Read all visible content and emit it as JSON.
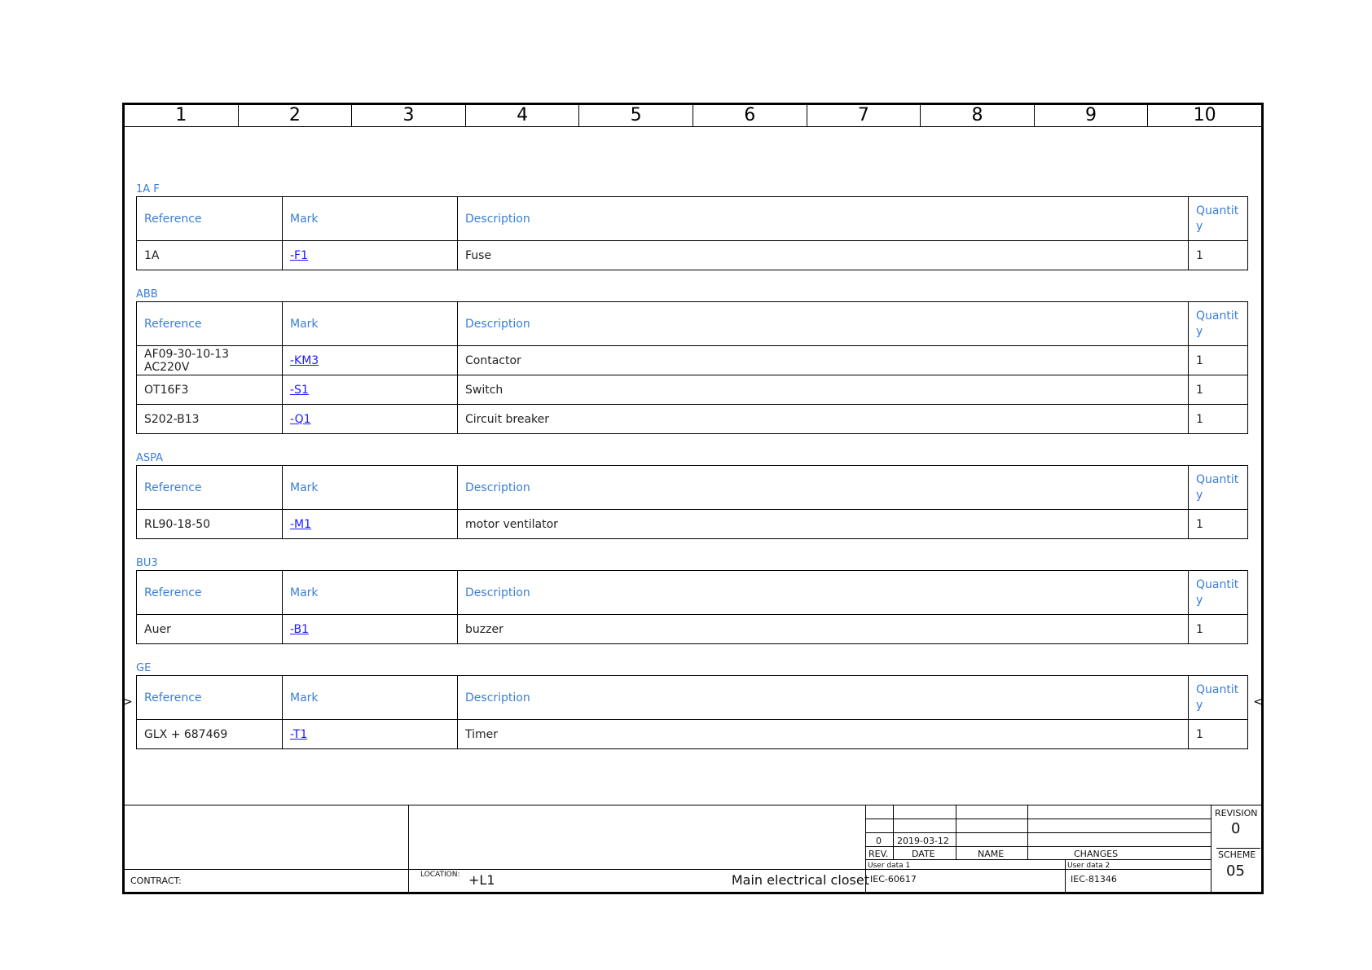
{
  "ruler": [
    "1",
    "2",
    "3",
    "4",
    "5",
    "6",
    "7",
    "8",
    "9",
    "10"
  ],
  "table_headers": {
    "reference": "Reference",
    "mark": "Mark",
    "description": "Description",
    "quantity_line1": "Quantit",
    "quantity_line2": "y"
  },
  "groups": [
    {
      "title": "1A F",
      "rows": [
        {
          "reference": "1A",
          "mark": "-F1",
          "description": "Fuse",
          "quantity": "1"
        }
      ]
    },
    {
      "title": "ABB",
      "rows": [
        {
          "reference": "AF09-30-10-13 AC220V",
          "mark": "-KM3",
          "description": "Contactor",
          "quantity": "1"
        },
        {
          "reference": "OT16F3",
          "mark": "-S1",
          "description": "Switch",
          "quantity": "1"
        },
        {
          "reference": "S202-B13",
          "mark": "-Q1",
          "description": "Circuit breaker",
          "quantity": "1"
        }
      ]
    },
    {
      "title": "ASPA",
      "rows": [
        {
          "reference": "RL90-18-50",
          "mark": "-M1",
          "description": "motor ventilator",
          "quantity": "1"
        }
      ]
    },
    {
      "title": "BU3",
      "rows": [
        {
          "reference": "Auer",
          "mark": "-B1",
          "description": "buzzer",
          "quantity": "1"
        }
      ]
    },
    {
      "title": "GE",
      "rows": [
        {
          "reference": "GLX + 687469",
          "mark": "-T1",
          "description": "Timer",
          "quantity": "1"
        }
      ]
    }
  ],
  "side_markers": {
    "left": ">",
    "right": "<"
  },
  "title_block": {
    "contract_label": "CONTRACT:",
    "location_label": "LOCATION:",
    "location_value": "+L1",
    "location_description": "Main electrical closet",
    "revision_table": {
      "rev_value": "0",
      "date_value": "2019-03-12",
      "rev_header": "REV.",
      "date_header": "DATE",
      "name_header": "NAME",
      "changes_header": "CHANGES"
    },
    "user_data_1_label": "User data 1",
    "user_data_1_value": "IEC-60617",
    "user_data_2_label": "User data 2",
    "user_data_2_value": "IEC-81346",
    "revision_label": "REVISION",
    "revision_value": "0",
    "scheme_label": "SCHEME",
    "scheme_value": "05"
  }
}
